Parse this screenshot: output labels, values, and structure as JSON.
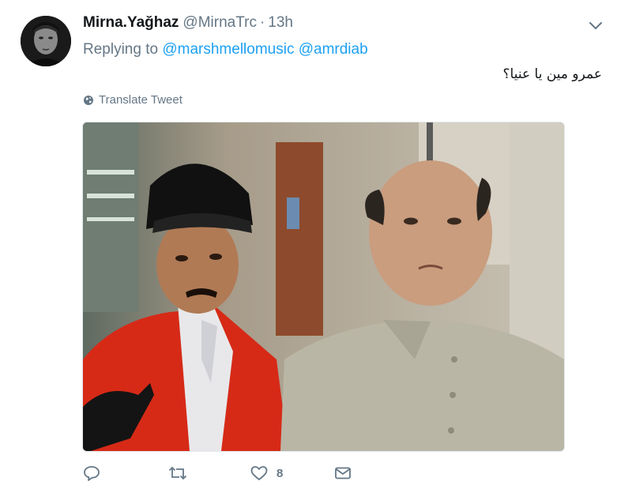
{
  "user": {
    "name": "Mirna.Yağhaz",
    "handle": "@MirnaTrc",
    "separator": "·",
    "time": "13h"
  },
  "reply": {
    "prefix": "Replying to",
    "mentions": [
      "@marshmellomusic",
      "@amrdiab"
    ]
  },
  "tweet_text": "عمرو مين يا عنيا؟",
  "translate_label": "Translate Tweet",
  "actions": {
    "reply_count": "",
    "retweet_count": "",
    "like_count": "8"
  },
  "colors": {
    "link": "#1da1f2",
    "secondary": "#657786",
    "text": "#14171a"
  },
  "icons": [
    "chevron-down-icon",
    "globe-icon",
    "reply-icon",
    "retweet-icon",
    "like-icon",
    "message-icon"
  ]
}
